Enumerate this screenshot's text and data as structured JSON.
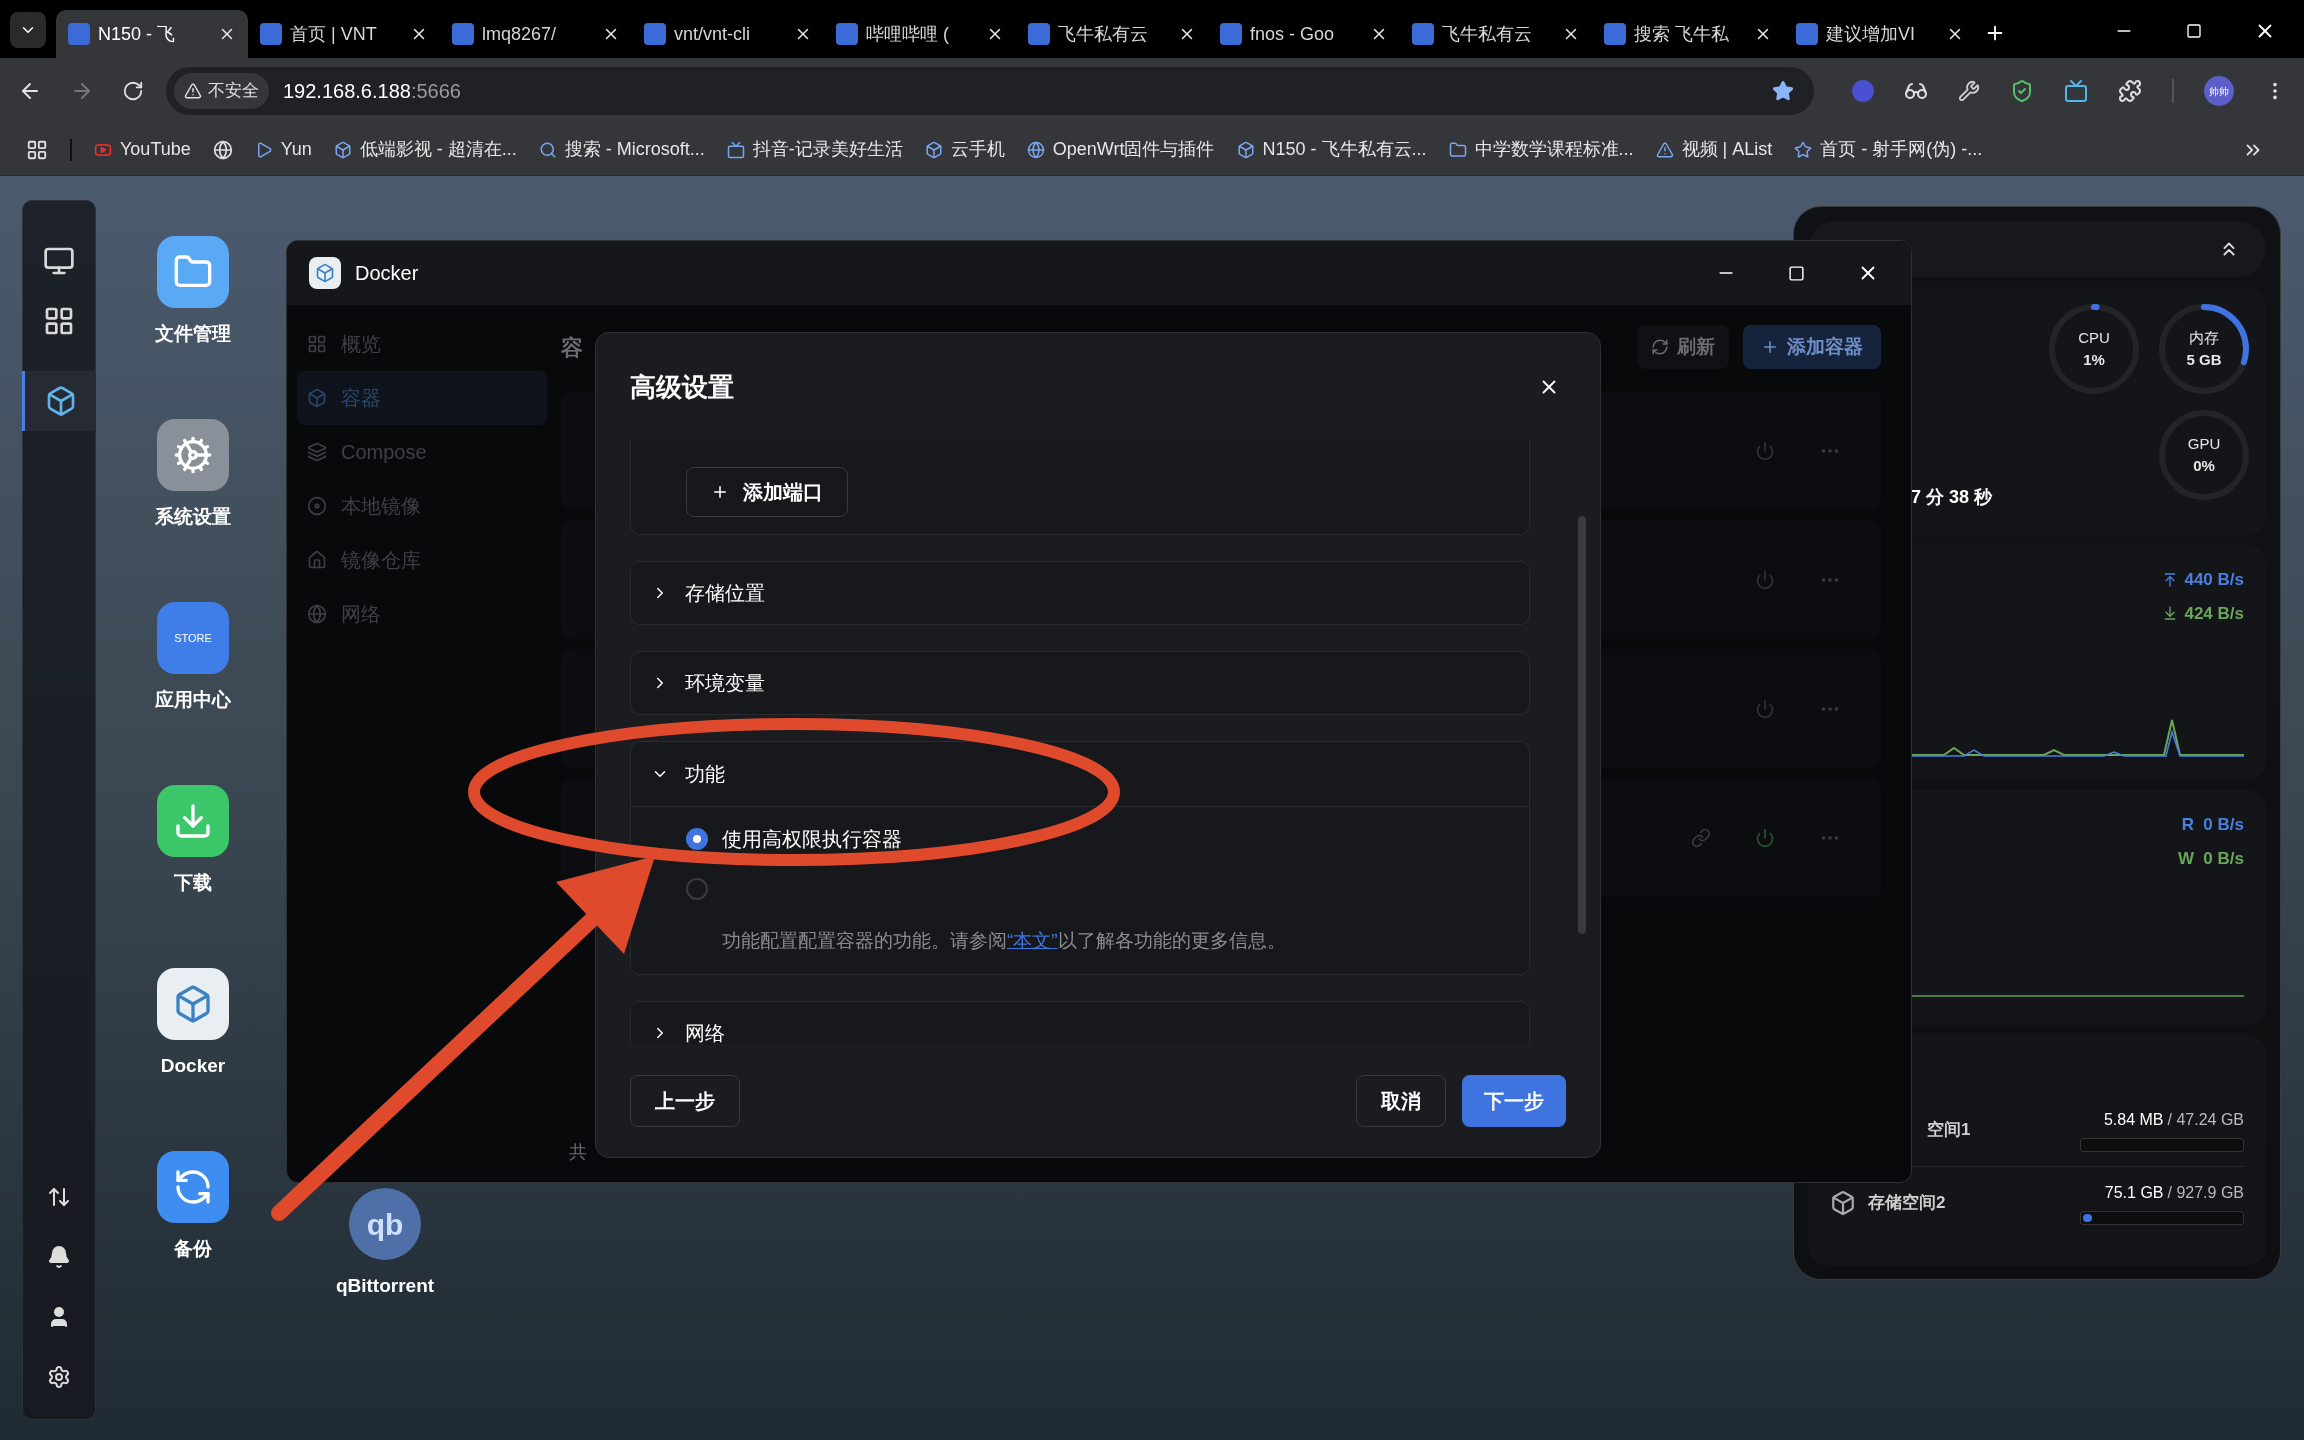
{
  "browser": {
    "tabs": [
      {
        "title": "N150 - 飞",
        "selected": true
      },
      {
        "title": "首页 | VNT",
        "selected": false
      },
      {
        "title": "lmq8267/",
        "selected": false
      },
      {
        "title": "vnt/vnt-cli",
        "selected": false
      },
      {
        "title": "哔哩哔哩 (",
        "selected": false
      },
      {
        "title": "飞牛私有云",
        "selected": false
      },
      {
        "title": "fnos - Goo",
        "selected": false
      },
      {
        "title": "飞牛私有云",
        "selected": false
      },
      {
        "title": "搜索 飞牛私",
        "selected": false
      },
      {
        "title": "建议增加VI",
        "selected": false
      }
    ],
    "address": {
      "security": "不安全",
      "host": "192.168.6.188",
      "port": ":5666"
    },
    "profile": "帅帅",
    "bookmarks": [
      {
        "kind": "link",
        "label": "YouTube"
      },
      {
        "kind": "icon"
      },
      {
        "kind": "link",
        "label": "Yun"
      },
      {
        "kind": "link",
        "label": "低端影视 - 超清在..."
      },
      {
        "kind": "link",
        "label": "搜索 - Microsoft..."
      },
      {
        "kind": "link",
        "label": "抖音-记录美好生活"
      },
      {
        "kind": "link",
        "label": "云手机"
      },
      {
        "kind": "link",
        "label": "OpenWrt固件与插件"
      },
      {
        "kind": "link",
        "label": "N150 - 飞牛私有云..."
      },
      {
        "kind": "link",
        "label": "中学数学课程标准..."
      },
      {
        "kind": "link",
        "label": "视频 | AList"
      },
      {
        "kind": "link",
        "label": "首页 - 射手网(伪) -..."
      }
    ]
  },
  "dock": {
    "apps": [
      {
        "selected": false
      },
      {
        "selected": false
      },
      {
        "selected": true
      }
    ]
  },
  "desktop_icons": [
    {
      "label": "文件管理"
    },
    {
      "label": "系统设置"
    },
    {
      "label": "应用中心",
      "icon_text": "STORE"
    },
    {
      "label": "下载"
    },
    {
      "label": "Docker"
    },
    {
      "label": "备份"
    }
  ],
  "qbittorrent": {
    "label": "qBittorrent",
    "icon_text": "qb"
  },
  "docker_window": {
    "title": "Docker",
    "sidebar": [
      {
        "label": "概览",
        "selected": false
      },
      {
        "label": "容器",
        "selected": true
      },
      {
        "label": "Compose",
        "selected": false
      },
      {
        "label": "本地镜像",
        "selected": false
      },
      {
        "label": "镜像仓库",
        "selected": false
      },
      {
        "label": "网络",
        "selected": false
      }
    ],
    "heading": "容",
    "refresh": "刷新",
    "add": "添加容器",
    "rows": [
      {
        "running": false,
        "link": false
      },
      {
        "running": false,
        "link": false
      },
      {
        "running": false,
        "link": false
      },
      {
        "running": true,
        "link": true
      }
    ],
    "footer": "共"
  },
  "dialog": {
    "title": "高级设置",
    "add_port": "添加端口",
    "sections": [
      {
        "label": "存储位置",
        "expanded": false
      },
      {
        "label": "环境变量",
        "expanded": false
      },
      {
        "label": "功能",
        "expanded": true,
        "options": [
          {
            "label": "使用高权限执行容器",
            "selected": true
          },
          {
            "selected": false
          }
        ],
        "description_before": "功能配置配置容器的功能。请参阅",
        "link": "“本文”",
        "description_after": "以了解各功能的更多信息。"
      },
      {
        "label": "网络",
        "expanded": false
      }
    ],
    "back": "上一步",
    "cancel": "取消",
    "next": "下一步"
  },
  "widgets": {
    "rings": [
      {
        "label": "CPU",
        "value": "1%",
        "level": 0.01
      },
      {
        "label": "内存",
        "value": "5 GB",
        "level": 0.3
      },
      {
        "label": "GPU",
        "value": "0%",
        "level": 0
      }
    ],
    "uptime": "7 分 38 秒",
    "network": {
      "up": "440 B/s",
      "down": "424 B/s"
    },
    "disk": {
      "read": "R  0 B/s",
      "write": "W  0 B/s"
    },
    "storage": [
      {
        "name": "空间1",
        "used": "5.84 MB",
        "total": "/ 47.24 GB",
        "level": 0,
        "icon": false
      },
      {
        "name": "存储空间2",
        "used": "75.1 GB",
        "total": "/ 927.9 GB",
        "level": 0.06,
        "icon": true
      }
    ]
  }
}
